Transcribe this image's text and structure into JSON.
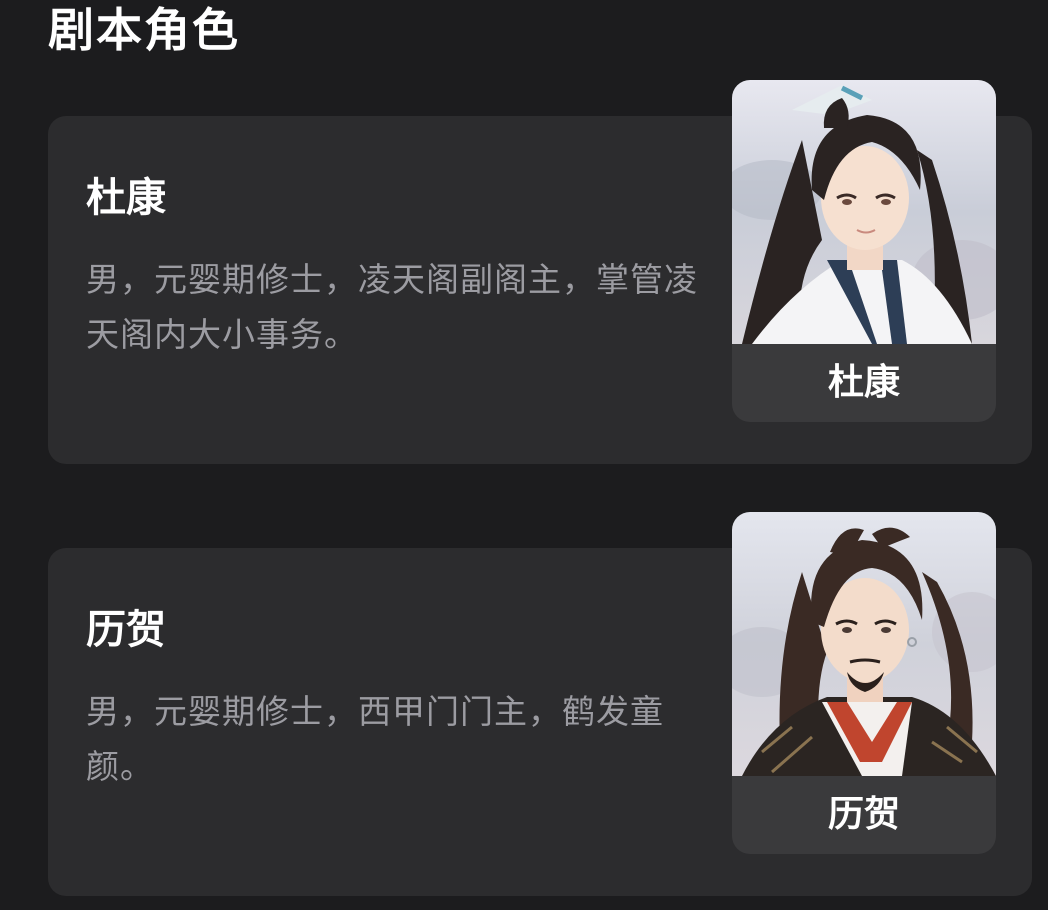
{
  "section": {
    "title": "剧本角色"
  },
  "characters": [
    {
      "name": "杜康",
      "description": "男，元婴期修士，凌天阁副阁主，掌管凌天阁内大小事务。",
      "portrait_label": "杜康"
    },
    {
      "name": "历贺",
      "description": "男，元婴期修士，西甲门门主，鹤发童颜。",
      "portrait_label": "历贺"
    }
  ],
  "colors": {
    "background": "#1c1c1e",
    "card": "#2c2c2e",
    "portrait_label_bg": "#3a3a3c",
    "title_text": "#ffffff",
    "description_text": "#9c9ca2"
  }
}
